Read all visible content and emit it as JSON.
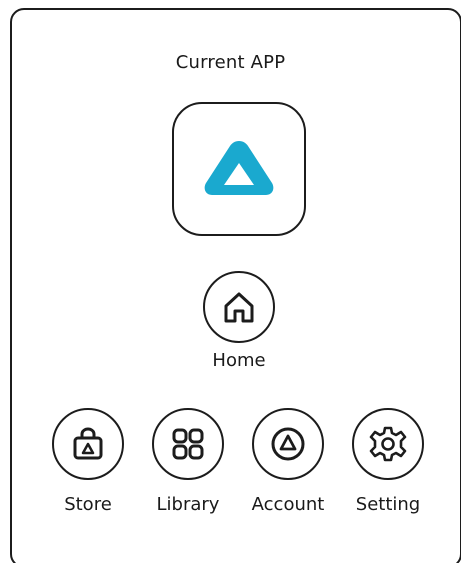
{
  "header": {
    "title": "Current APP"
  },
  "current_app": {
    "icon": "vive-logo-icon",
    "brand_color": "#1aa9cf"
  },
  "home": {
    "label": "Home",
    "icon": "home-icon"
  },
  "nav": [
    {
      "label": "Store",
      "icon": "store-bag-icon"
    },
    {
      "label": "Library",
      "icon": "library-grid-icon"
    },
    {
      "label": "Account",
      "icon": "account-icon"
    },
    {
      "label": "Setting",
      "icon": "gear-icon"
    }
  ],
  "colors": {
    "stroke": "#1c1c1c",
    "background": "#ffffff",
    "accent": "#1aa9cf"
  }
}
